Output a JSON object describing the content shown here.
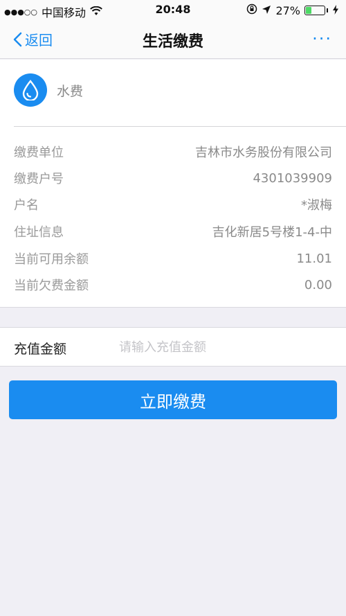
{
  "status_bar": {
    "signal": "●●●○○",
    "carrier": "中国移动",
    "time": "20:48",
    "battery_text": "27%",
    "battery_level": 0.27
  },
  "nav": {
    "back_label": "返回",
    "title": "生活缴费",
    "more_label": "···"
  },
  "bill": {
    "type": "水费",
    "rows": [
      {
        "label": "缴费单位",
        "value": "吉林市水务股份有限公司"
      },
      {
        "label": "缴费户号",
        "value": "4301039909"
      },
      {
        "label": "户名",
        "value": "*淑梅"
      },
      {
        "label": "住址信息",
        "value": "吉化新居5号楼1-4-中"
      },
      {
        "label": "当前可用余额",
        "value": "11.01"
      },
      {
        "label": "当前欠费金额",
        "value": "0.00"
      }
    ]
  },
  "amount": {
    "label": "充值金额",
    "placeholder": "请输入充值金额",
    "value": ""
  },
  "pay_button_label": "立即缴费",
  "colors": {
    "accent": "#1a8cf0",
    "background": "#f0eff5"
  }
}
